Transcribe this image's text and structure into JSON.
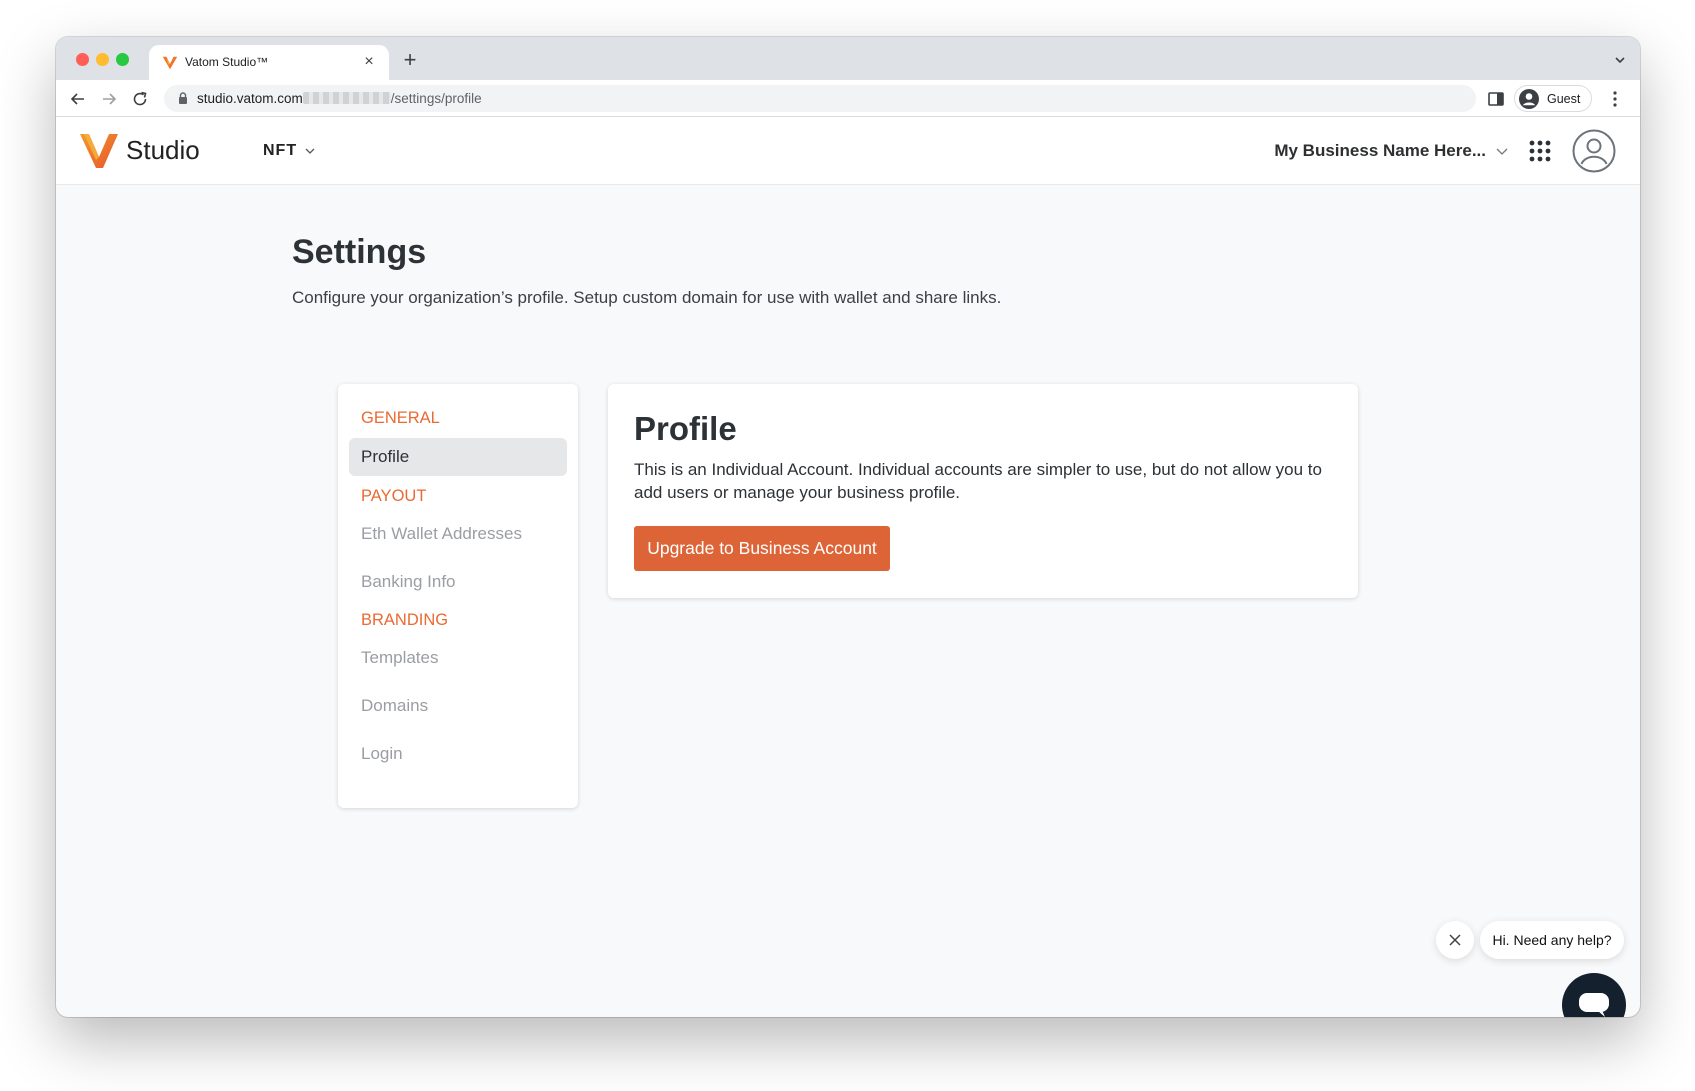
{
  "browser": {
    "tab_title": "Vatom Studio™",
    "new_tab_label": "+",
    "close_tab_label": "×",
    "url_host": "studio.vatom.com",
    "url_path": "/settings/profile",
    "profile_label": "Guest"
  },
  "header": {
    "logo_text": "Studio",
    "product_switch": "NFT",
    "org_name": "My Business Name Here..."
  },
  "page": {
    "title": "Settings",
    "subtitle": "Configure your organization’s profile. Setup custom domain for use with wallet and share links."
  },
  "settings_nav": {
    "general_label": "GENERAL",
    "profile": "Profile",
    "payout_label": "PAYOUT",
    "eth_wallet": "Eth Wallet Addresses",
    "banking": "Banking Info",
    "branding_label": "BRANDING",
    "templates": "Templates",
    "domains": "Domains",
    "login": "Login"
  },
  "profile_card": {
    "title": "Profile",
    "body": "This is an Individual Account. Individual accounts are simpler to use, but do not allow you to add users or manage your business profile.",
    "upgrade_button": "Upgrade to Business Account"
  },
  "help": {
    "bubble_text": "Hi. Need any help?"
  },
  "colors": {
    "accent": "#dd6437",
    "section_label": "#ea6a33",
    "chat_button": "#15202e"
  }
}
